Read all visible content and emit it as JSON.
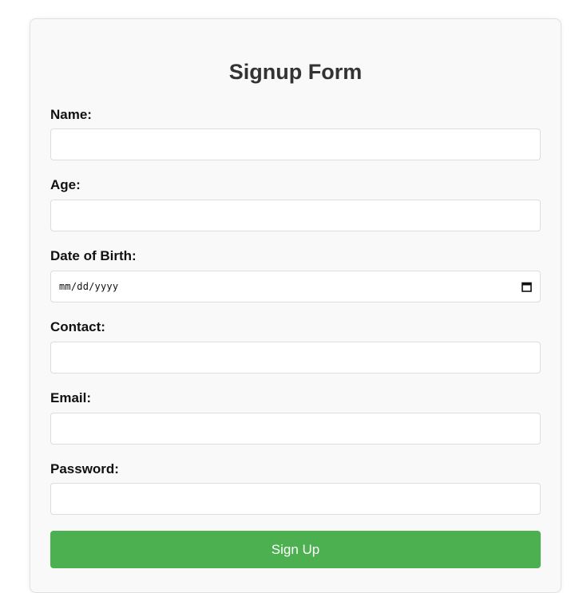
{
  "form": {
    "title": "Signup Form",
    "fields": [
      {
        "label": "Name:",
        "value": ""
      },
      {
        "label": "Age:",
        "value": ""
      },
      {
        "label": "Date of Birth:",
        "placeholder": "mm/dd/yyyy"
      },
      {
        "label": "Contact:",
        "value": ""
      },
      {
        "label": "Email:",
        "value": ""
      },
      {
        "label": "Password:",
        "value": ""
      }
    ],
    "submit_label": "Sign Up"
  },
  "colors": {
    "button_bg": "#4caf50",
    "button_text": "#ffffff",
    "card_bg": "#f9f9f9",
    "title_text": "#333333"
  },
  "icons": {
    "date_picker": "calendar-icon"
  }
}
